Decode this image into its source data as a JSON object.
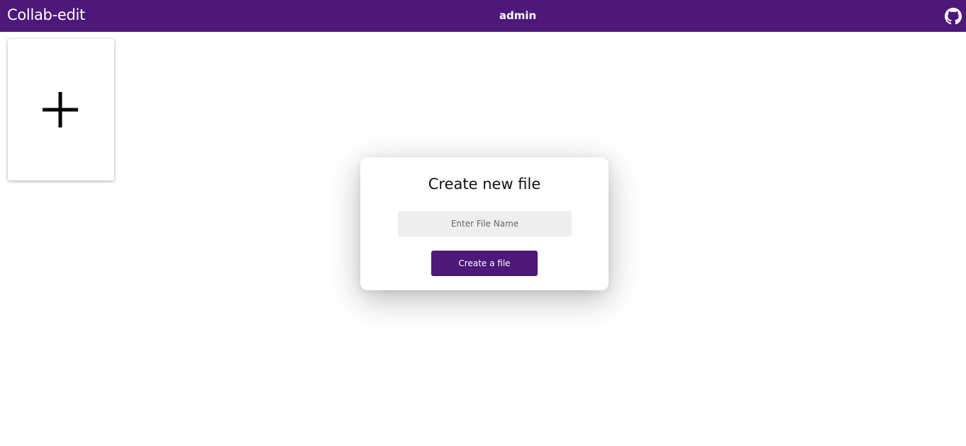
{
  "header": {
    "app_title": "Collab-edit",
    "username": "admin",
    "github_icon": "github-icon"
  },
  "files": {
    "new_file_icon": "plus-icon"
  },
  "modal": {
    "title": "Create new file",
    "file_name_placeholder": "Enter File Name",
    "file_name_value": "",
    "create_button_label": "Create a file"
  },
  "colors": {
    "brand": "#4e177a",
    "input_background": "#eeeeee",
    "page_background": "#ffffff"
  }
}
